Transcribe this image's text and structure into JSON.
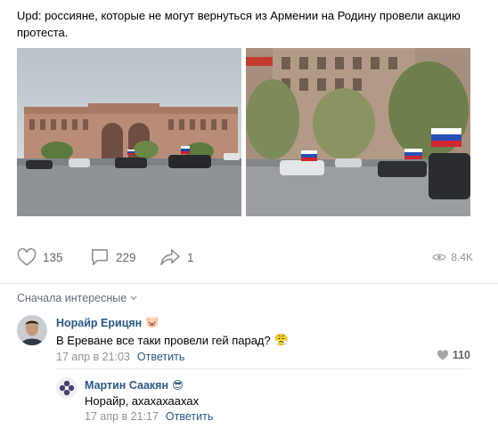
{
  "post": {
    "text": "Upd: россияне, которые не могут вернуться из Армении на Родину провели акцию протеста."
  },
  "actions": {
    "likes": "135",
    "comments": "229",
    "shares": "1",
    "views": "8.4K"
  },
  "comments_section": {
    "sort_label": "Сначала интересные"
  },
  "comments": [
    {
      "author": "Норайр Ерицян",
      "author_emoji": "🐷",
      "text": "В Ереване все таки провели гей парад?",
      "text_emoji": "😤",
      "date": "17 апр в 21:03",
      "reply_label": "Ответить",
      "likes": "110"
    },
    {
      "author": "Мартин Саакян",
      "author_emoji": "😎",
      "text": "Норайр, ахахахаахах",
      "date": "17 апр в 21:17",
      "reply_label": "Ответить"
    }
  ],
  "colors": {
    "link_blue": "#2a5885",
    "muted_gray": "#939393",
    "icon_gray": "#656565"
  }
}
